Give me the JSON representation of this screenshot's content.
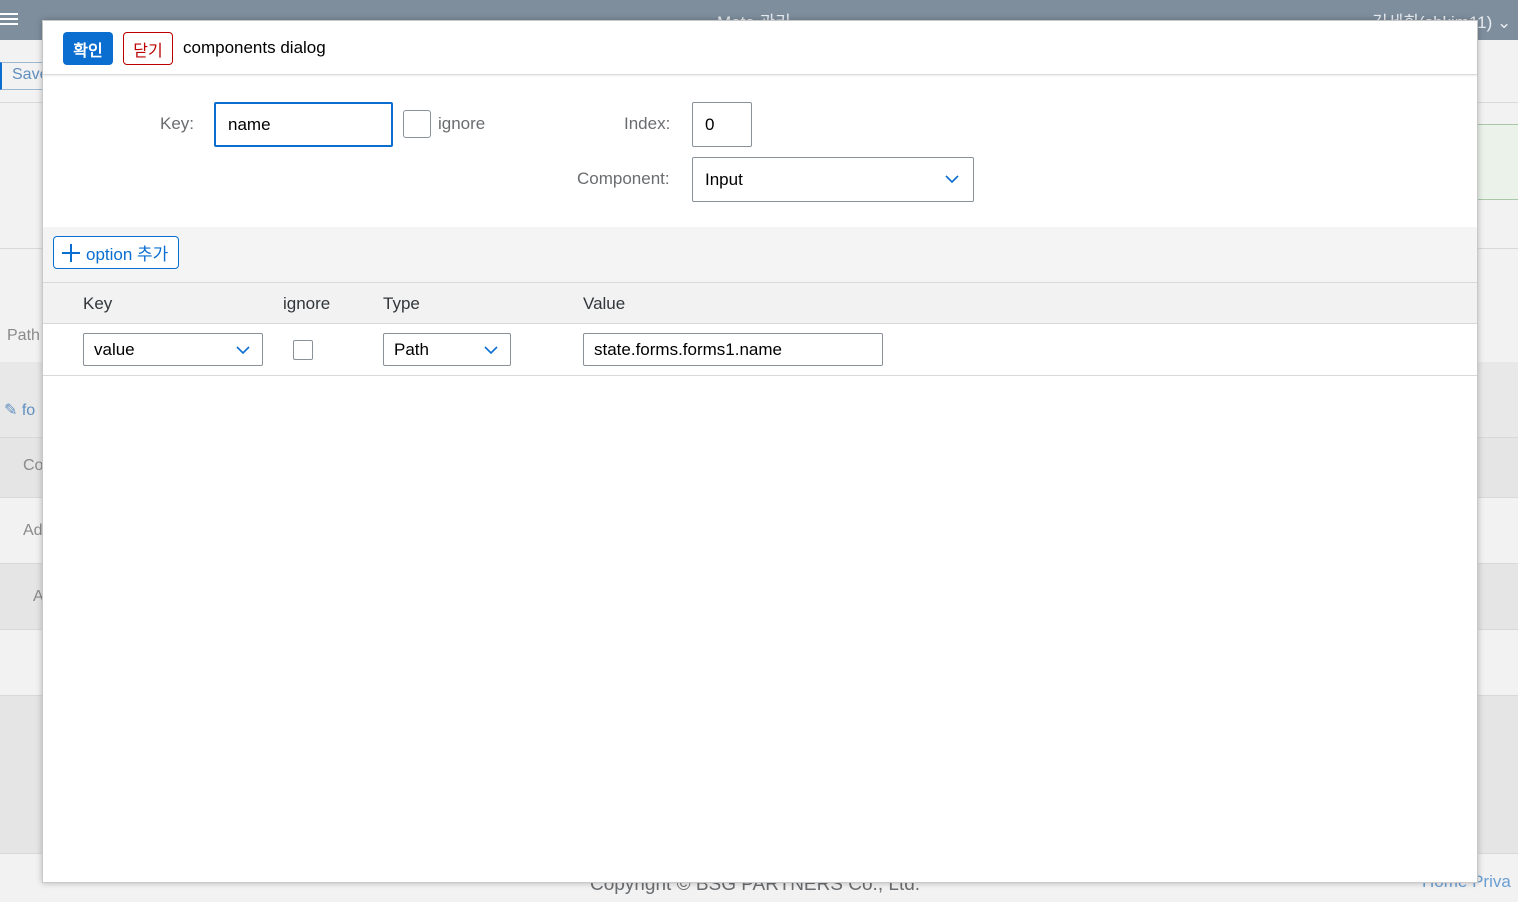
{
  "background": {
    "shell_title": "Meta 관리",
    "user_name": "김세희(shkim11)",
    "save_label": "Save",
    "path_label": "Path",
    "edit_label": "fo",
    "row_labels": [
      "Co",
      "Ad",
      "A"
    ],
    "footer": "Copyright © BSG PARTNERS Co., Ltd.",
    "footer_links": "Home  Priva"
  },
  "dialog": {
    "confirm_label": "확인",
    "close_label": "닫기",
    "title": "components dialog",
    "form": {
      "key_label": "Key:",
      "key_value": "name",
      "ignore_label": "ignore",
      "index_label": "Index:",
      "index_value": "0",
      "component_label": "Component:",
      "component_value": "Input"
    },
    "add_option_label": "option 추가",
    "table": {
      "headers": [
        "Key",
        "ignore",
        "Type",
        "Value"
      ],
      "rows": [
        {
          "key": "value",
          "ignore": false,
          "type": "Path",
          "value": "state.forms.forms1.name"
        }
      ]
    }
  },
  "colors": {
    "accent": "#0a6ed1",
    "reject": "#bb0000",
    "shell": "#7e8e9d"
  }
}
